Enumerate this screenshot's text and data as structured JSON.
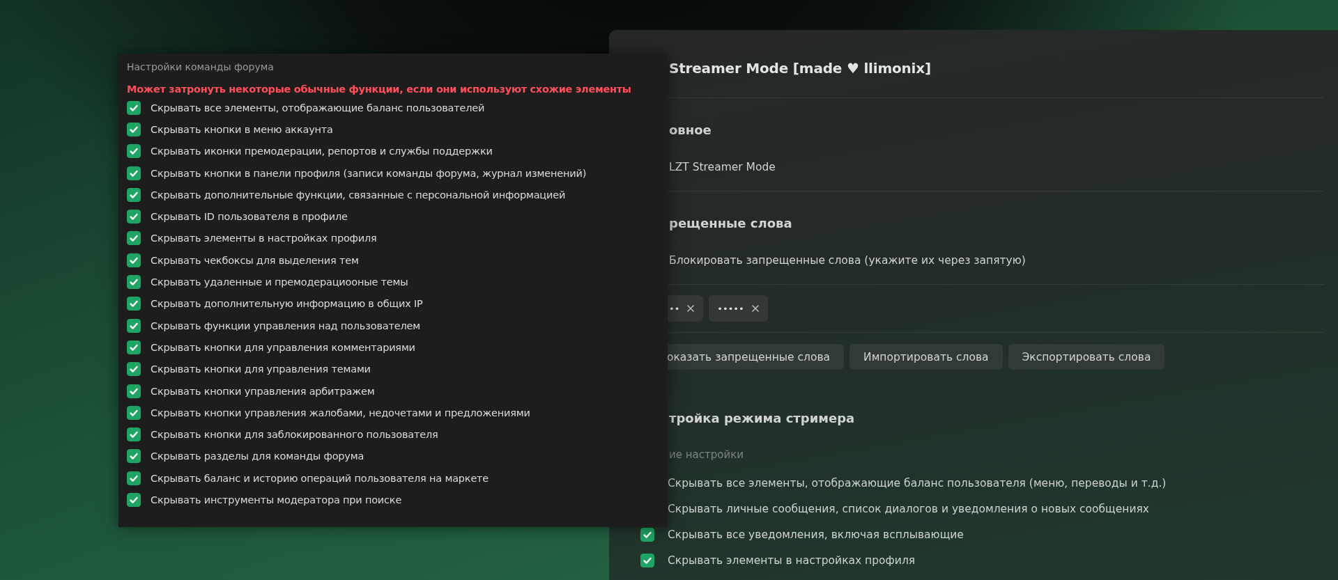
{
  "settings_panel": {
    "title": "Streamer Mode [made ♥ llimonix]",
    "items": [
      {
        "kind": "divider"
      },
      {
        "kind": "heading",
        "text": "овное"
      },
      {
        "kind": "text",
        "text": "LZT Streamer Mode"
      },
      {
        "kind": "divider"
      },
      {
        "kind": "heading",
        "text": "рещенные слова"
      },
      {
        "kind": "text",
        "text": "Блокировать запрещенные слова (укажите их через запятую)"
      },
      {
        "kind": "divider"
      },
      {
        "kind": "tags",
        "tags": [
          "••",
          "•••••"
        ]
      },
      {
        "kind": "divider"
      },
      {
        "kind": "buttons",
        "buttons": [
          "оказать запрещенные слова",
          "Импортировать слова",
          "Экспортировать слова"
        ]
      },
      {
        "kind": "heading",
        "text": "тройка режима стримера"
      },
      {
        "kind": "subheading",
        "text": "ие настройки"
      },
      {
        "kind": "checkbox",
        "label": "Скрывать все элементы, отображающие баланс пользователя (меню, переводы и т.д.)"
      },
      {
        "kind": "checkbox",
        "label": "Скрывать личные сообщения, список диалогов и уведомления о новых сообщениях"
      },
      {
        "kind": "checkbox",
        "label": "Скрывать все уведомления, включая всплывающие",
        "checked": true
      },
      {
        "kind": "checkbox",
        "label": "Скрывать элементы в настройках профиля",
        "checked": true
      }
    ]
  },
  "popup": {
    "title": "Настройки команды форума",
    "warning": "Может затронуть некоторые обычные функции, если они используют схожие элементы",
    "options": [
      {
        "label": "Скрывать все элементы, отображающие баланс пользователей",
        "checked": true
      },
      {
        "label": "Скрывать кнопки в меню аккаунта",
        "checked": true
      },
      {
        "label": "Скрывать иконки премодерации, репортов и службы поддержки",
        "checked": true
      },
      {
        "label": "Скрывать кнопки в панели профиля (записи команды форума, журнал изменений)",
        "checked": true
      },
      {
        "label": "Скрывать дополнительные функции, связанные с персональной информацией",
        "checked": true
      },
      {
        "label": "Скрывать ID пользователя в профиле",
        "checked": true
      },
      {
        "label": "Скрывать элементы в настройках профиля",
        "checked": true
      },
      {
        "label": "Скрывать чекбоксы для выделения тем",
        "checked": true
      },
      {
        "label": "Скрывать удаленные и премодерациооные темы",
        "checked": true
      },
      {
        "label": "Скрывать дополнительную информацию в общих IP",
        "checked": true
      },
      {
        "label": "Скрывать функции управления над пользователем",
        "checked": true
      },
      {
        "label": "Скрывать кнопки для управления комментариями",
        "checked": true
      },
      {
        "label": "Скрывать кнопки для управления темами",
        "checked": true
      },
      {
        "label": "Скрывать кнопки управления арбитражем",
        "checked": true
      },
      {
        "label": "Скрывать кнопки управления жалобами, недочетами и предложениями",
        "checked": true
      },
      {
        "label": "Скрывать кнопки для заблокированного пользователя",
        "checked": true
      },
      {
        "label": "Скрывать разделы для команды форума",
        "checked": true
      },
      {
        "label": "Скрывать баланс и историю операций пользователя на маркете",
        "checked": true
      },
      {
        "label": "Скрывать инструменты модератора при поиске",
        "checked": true
      }
    ]
  }
}
